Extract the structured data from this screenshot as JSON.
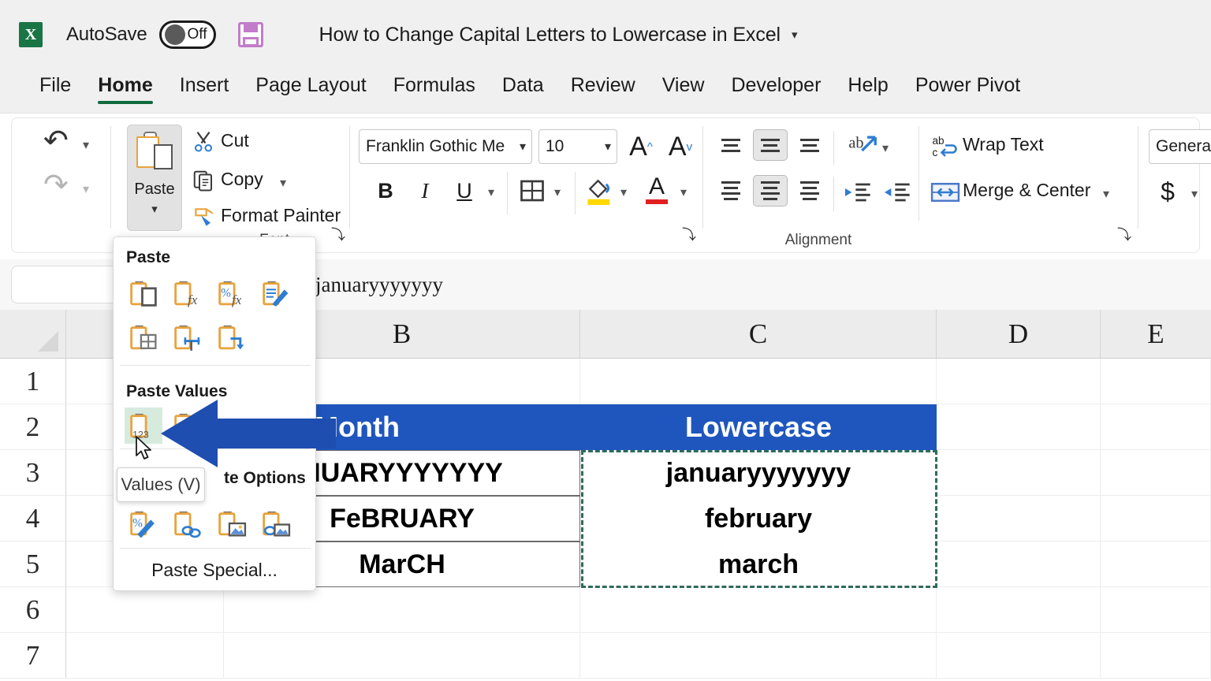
{
  "titlebar": {
    "app_icon": "excel-icon",
    "autosave_label": "AutoSave",
    "autosave_state": "Off",
    "save_icon": "save-icon",
    "document_title": "How to Change Capital Letters to Lowercase in Excel",
    "title_caret": "▾"
  },
  "ribbon_tabs": [
    {
      "label": "File",
      "active": false
    },
    {
      "label": "Home",
      "active": true
    },
    {
      "label": "Insert",
      "active": false
    },
    {
      "label": "Page Layout",
      "active": false
    },
    {
      "label": "Formulas",
      "active": false
    },
    {
      "label": "Data",
      "active": false
    },
    {
      "label": "Review",
      "active": false
    },
    {
      "label": "View",
      "active": false
    },
    {
      "label": "Developer",
      "active": false
    },
    {
      "label": "Help",
      "active": false
    },
    {
      "label": "Power Pivot",
      "active": false
    }
  ],
  "ribbon": {
    "undo_group": {
      "label": "Undo",
      "undo_icon": "undo-arrow-icon",
      "redo_icon": "redo-arrow-icon"
    },
    "clipboard_group": {
      "paste_label": "Paste",
      "cut_label": "Cut",
      "copy_label": "Copy",
      "format_painter_label": "Format Painter",
      "dialog_launcher": "⤵"
    },
    "font_group": {
      "label": "Font",
      "font_name": "Franklin Gothic Me",
      "font_size": "10",
      "grow_font": "A",
      "shrink_font": "A",
      "bold": "B",
      "italic": "I",
      "underline": "U",
      "borders_icon": "borders-icon",
      "fill_color_icon": "fill-color-icon",
      "font_color_icon": "font-color-icon",
      "dialog_launcher": "⤵"
    },
    "alignment_group": {
      "label": "Alignment",
      "orientation_icon": "orientation-icon",
      "wrap_text_label": "Wrap Text",
      "merge_center_label": "Merge & Center",
      "decrease_indent_icon": "decrease-indent-icon",
      "increase_indent_icon": "increase-indent-icon",
      "dialog_launcher": "⤵"
    },
    "number_group": {
      "format_value": "General",
      "currency_symbol": "$"
    }
  },
  "paste_menu": {
    "paste_section_title": "Paste",
    "paste_values_section_title": "Paste Values",
    "other_paste_options_title": "te Options",
    "paste_special_label": "Paste Special...",
    "paste_icons": [
      "paste-all-icon",
      "paste-formulas-icon",
      "paste-formulas-number-formatting-icon",
      "paste-formatting-icon",
      "paste-no-borders-icon",
      "paste-keep-column-widths-icon",
      "paste-transpose-icon"
    ],
    "paste_values_icons": [
      "paste-values-icon",
      "paste-values-number-formatting-icon"
    ],
    "other_paste_options_icons": [
      "paste-formatting-only-icon",
      "paste-link-icon",
      "paste-picture-icon",
      "paste-linked-picture-icon"
    ],
    "highlighted_icon": "paste-values-icon",
    "tooltip_text": "Values (V)"
  },
  "formula_bar": {
    "name_box_value": "",
    "formula_value": "januaryyyyyyy"
  },
  "sheet": {
    "column_headers": [
      "B",
      "C",
      "D",
      "E"
    ],
    "row_headers": [
      "1",
      "2",
      "3",
      "4",
      "5",
      "6",
      "7"
    ],
    "header_row": {
      "b": "Month",
      "c": "Lowercase"
    },
    "rows": [
      {
        "b": "NUARYYYYYYY",
        "c": "januaryyyyyyy"
      },
      {
        "b": "FeBRUARY",
        "c": "february"
      },
      {
        "b": "MarCH",
        "c": "march"
      }
    ],
    "selection_range_border": "marching-ants",
    "annotation_arrow": "left-pointing-arrow"
  },
  "colors": {
    "header_blue": "#1f56be",
    "arrow_blue": "#1e4eb0",
    "tab_accent_green": "#0f6b3d",
    "highlight_green": "#d7eade",
    "marquee_green": "#2f6b5a",
    "clipboard_orange": "#e8a33d"
  }
}
